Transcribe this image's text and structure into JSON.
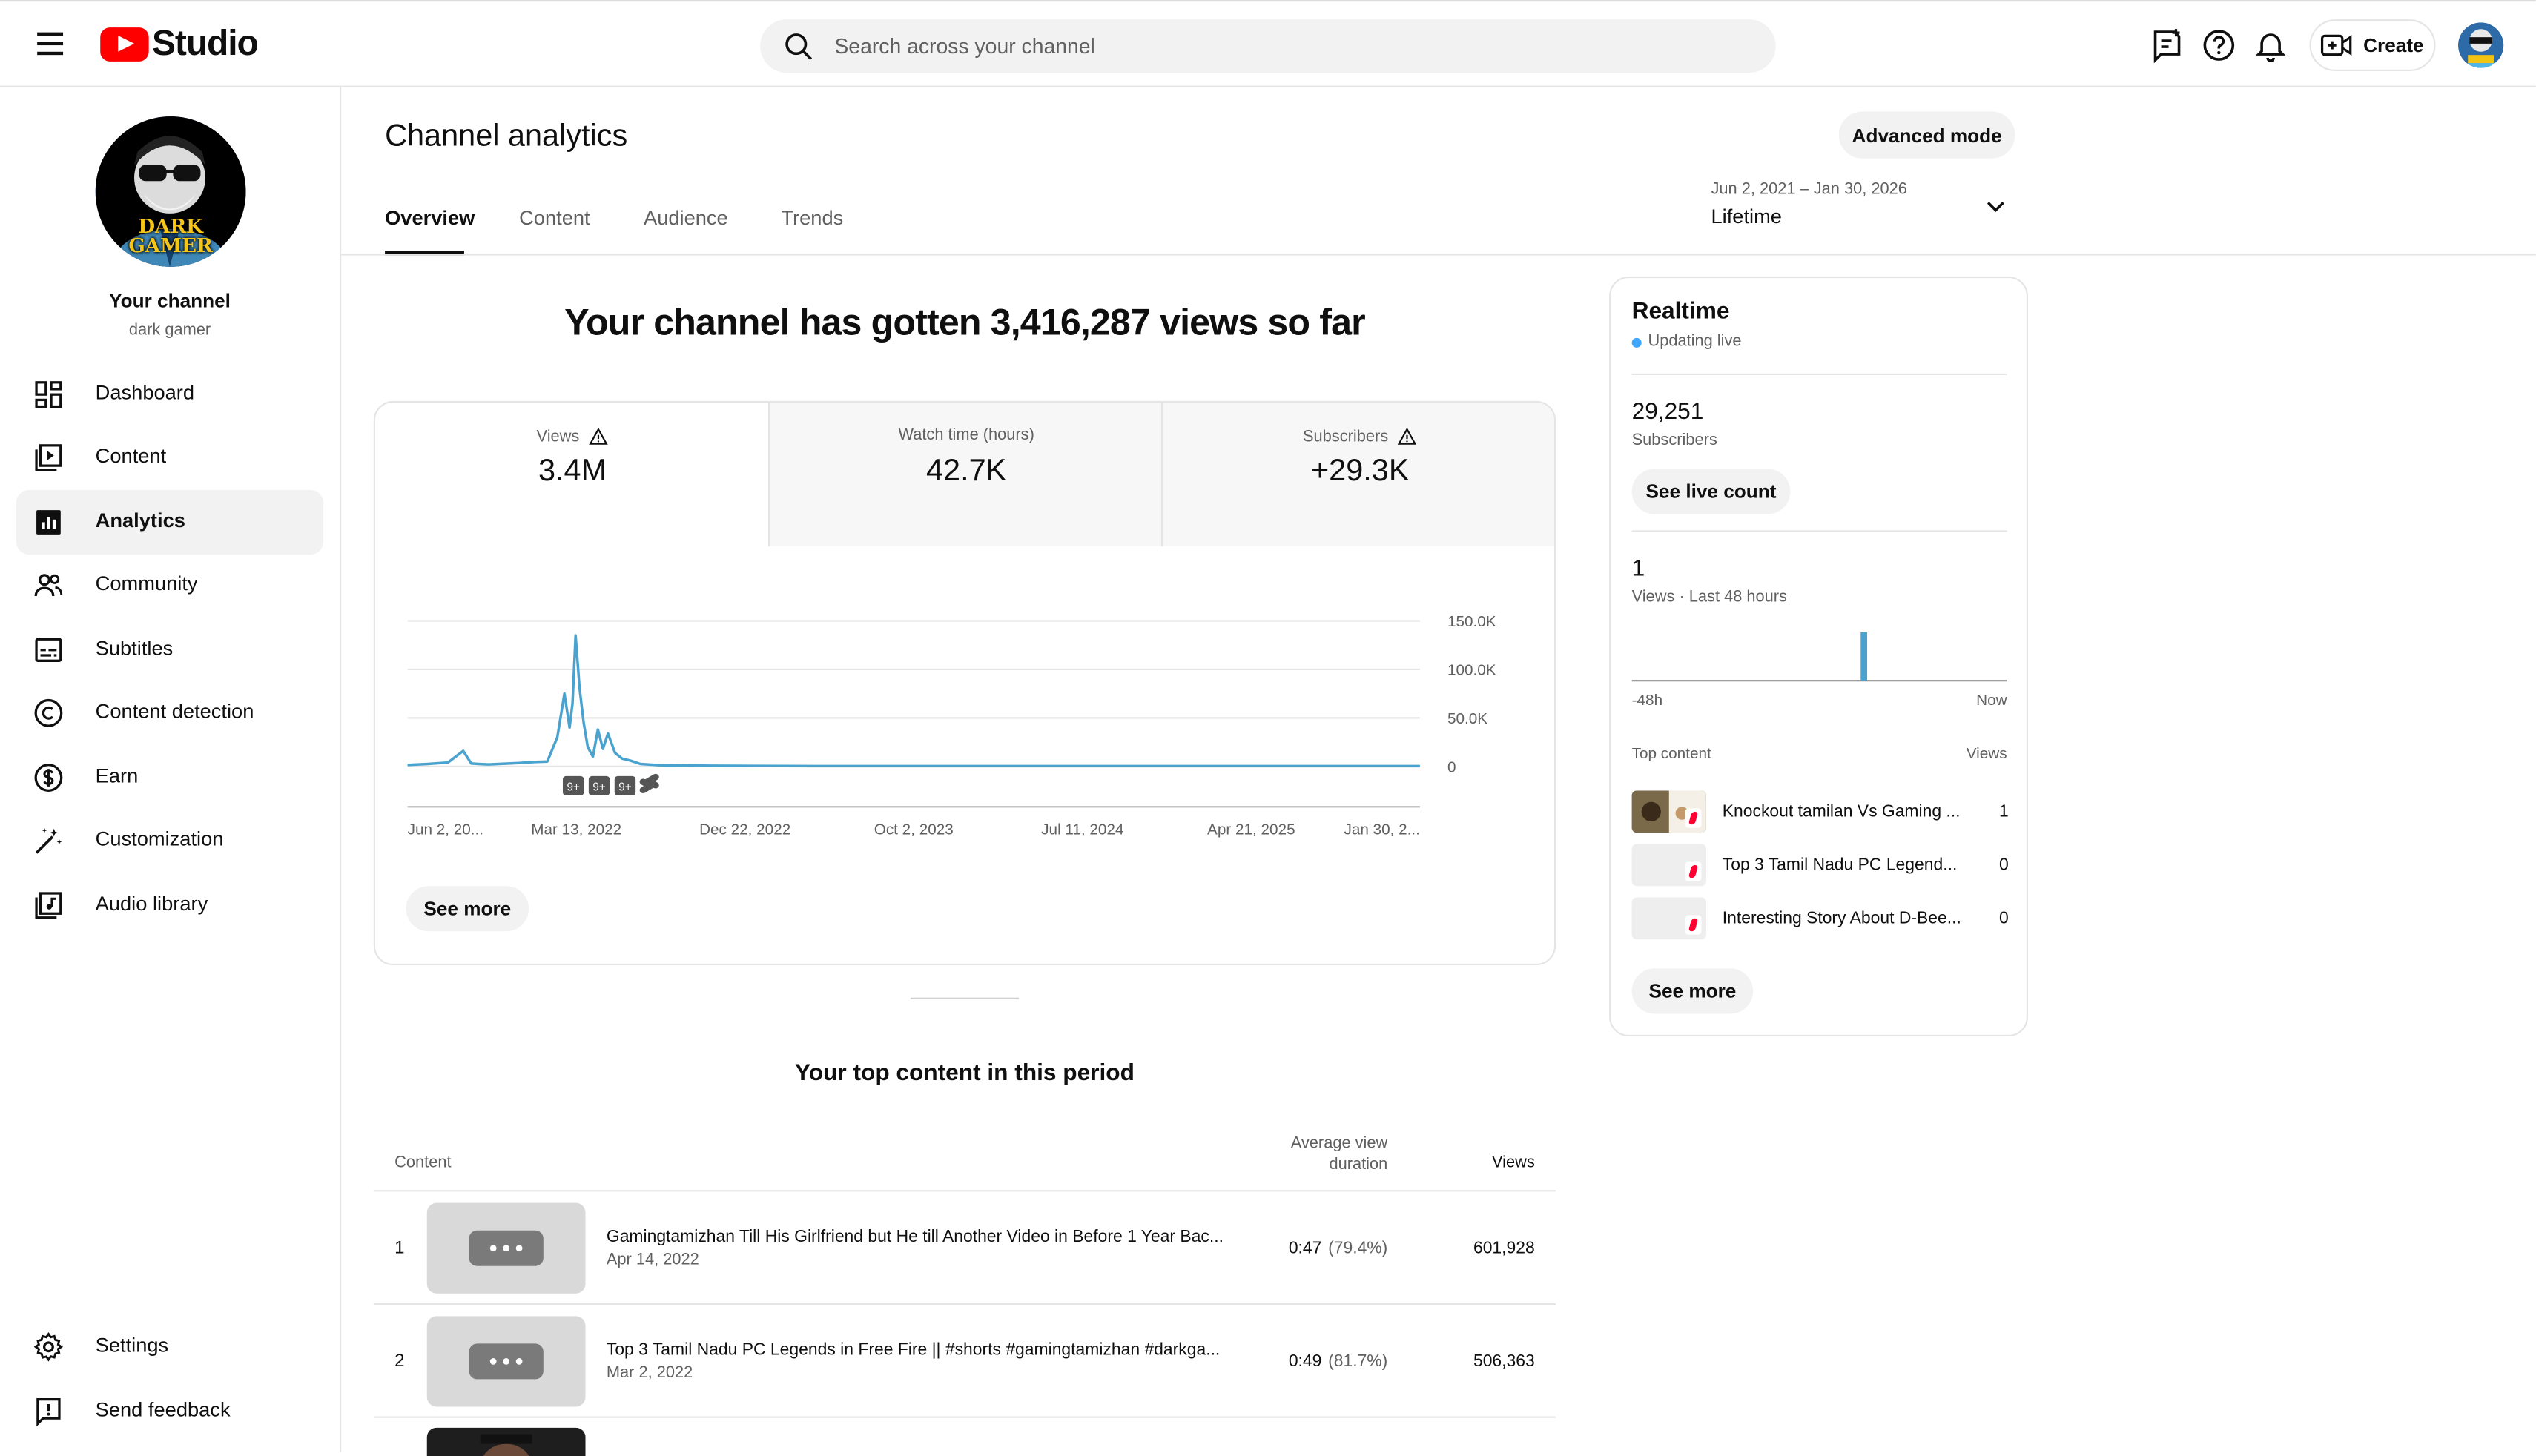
{
  "header": {
    "logo_text": "Studio",
    "search_placeholder": "Search across your channel",
    "create_label": "Create"
  },
  "sidebar": {
    "channel_name": "Your channel",
    "channel_handle": "dark gamer",
    "avatar_text_line1": "DARK",
    "avatar_text_line2": "GAMER",
    "items": [
      {
        "label": "Dashboard",
        "icon": "dashboard-icon"
      },
      {
        "label": "Content",
        "icon": "content-icon"
      },
      {
        "label": "Analytics",
        "icon": "analytics-icon",
        "active": true
      },
      {
        "label": "Community",
        "icon": "community-icon"
      },
      {
        "label": "Subtitles",
        "icon": "subtitles-icon"
      },
      {
        "label": "Content detection",
        "icon": "copyright-icon"
      },
      {
        "label": "Earn",
        "icon": "dollar-icon"
      },
      {
        "label": "Customization",
        "icon": "magic-wand-icon"
      },
      {
        "label": "Audio library",
        "icon": "audio-library-icon"
      }
    ],
    "bottom_items": [
      {
        "label": "Settings",
        "icon": "gear-icon"
      },
      {
        "label": "Send feedback",
        "icon": "feedback-icon"
      }
    ]
  },
  "main": {
    "title": "Channel analytics",
    "advanced_mode_label": "Advanced mode",
    "tabs": [
      "Overview",
      "Content",
      "Audience",
      "Trends"
    ],
    "date_range": "Jun 2, 2021 – Jan 30, 2026",
    "date_label": "Lifetime",
    "headline": "Your channel has gotten 3,416,287 views so far",
    "metrics": [
      {
        "label": "Views",
        "value": "3.4M",
        "warning": true
      },
      {
        "label": "Watch time (hours)",
        "value": "42.7K",
        "warning": false
      },
      {
        "label": "Subscribers",
        "value": "+29.3K",
        "warning": true
      }
    ],
    "see_more_label": "See more",
    "top_content_title": "Your top content in this period",
    "table_headers": {
      "content": "Content",
      "avd_line1": "Average view",
      "avd_line2": "duration",
      "views": "Views"
    },
    "rows": [
      {
        "index": "1",
        "title": "Gamingtamizhan Till His Girlfriend but He till Another Video in Before 1 Year Bac...",
        "date": "Apr 14, 2022",
        "avd": "0:47",
        "avd_pct": "(79.4%)",
        "views": "601,928"
      },
      {
        "index": "2",
        "title": "Top 3 Tamil Nadu PC Legends in Free Fire || #shorts #gamingtamizhan #darkga...",
        "date": "Mar 2, 2022",
        "avd": "0:49",
        "avd_pct": "(81.7%)",
        "views": "506,363"
      }
    ]
  },
  "chart_data": {
    "type": "line",
    "series": [
      {
        "name": "Views",
        "color": "#4aa3cf"
      }
    ],
    "x_tick_labels": [
      "Jun 2, 20...",
      "Mar 13, 2022",
      "Dec 22, 2022",
      "Oct 2, 2023",
      "Jul 11, 2024",
      "Apr 21, 2025",
      "Jan 30, 2..."
    ],
    "y_tick_labels": [
      "150.0K",
      "100.0K",
      "50.0K",
      "0"
    ],
    "ylim": [
      0,
      150000
    ],
    "y_ticks": [
      0,
      50000,
      100000,
      150000
    ],
    "x_ticks": [
      0,
      0.1667,
      0.3333,
      0.5,
      0.6667,
      0.8333,
      1
    ],
    "x_points": [
      0,
      0.02,
      0.04,
      0.055,
      0.063,
      0.07,
      0.08,
      0.09,
      0.1,
      0.11,
      0.125,
      0.138,
      0.148,
      0.155,
      0.16,
      0.163,
      0.166,
      0.17,
      0.174,
      0.178,
      0.183,
      0.188,
      0.193,
      0.198,
      0.205,
      0.212,
      0.22,
      0.23,
      0.25,
      0.3,
      0.4,
      0.6,
      0.8,
      1
    ],
    "y_values": [
      1500,
      2500,
      4000,
      16000,
      3000,
      2500,
      2000,
      2500,
      3000,
      3500,
      4500,
      5000,
      30000,
      75000,
      40000,
      65000,
      135000,
      80000,
      45000,
      20000,
      10000,
      38000,
      18000,
      34000,
      14000,
      8000,
      6000,
      2500,
      1200,
      600,
      400,
      300,
      300,
      300
    ],
    "markers": [
      "9+",
      "9+",
      "9+",
      "shorts"
    ],
    "grid": true
  },
  "realtime": {
    "title": "Realtime",
    "live_label": "Updating live",
    "subscribers_value": "29,251",
    "subscribers_label": "Subscribers",
    "live_count_label": "See live count",
    "views_value": "1",
    "views_label": "Views · Last 48 hours",
    "axis_start": "-48h",
    "axis_end": "Now",
    "bar_position": 0.61,
    "top_content_label": "Top content",
    "views_col_label": "Views",
    "items": [
      {
        "title": "Knockout tamilan Vs Gaming ...",
        "views": "1"
      },
      {
        "title": "Top 3 Tamil Nadu PC Legend...",
        "views": "0"
      },
      {
        "title": "Interesting Story About D-Bee...",
        "views": "0"
      }
    ],
    "see_more_label": "See more"
  }
}
